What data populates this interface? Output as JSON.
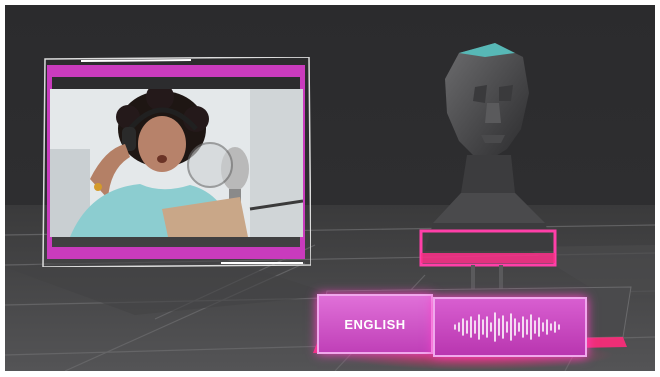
{
  "scene": {
    "language_label": "ENGLISH",
    "waveform_icon": "audio-waveform-icon",
    "head_icon": "low-poly-head-icon",
    "accent_color": "#e040c8",
    "glow_color": "#ff3a78"
  }
}
